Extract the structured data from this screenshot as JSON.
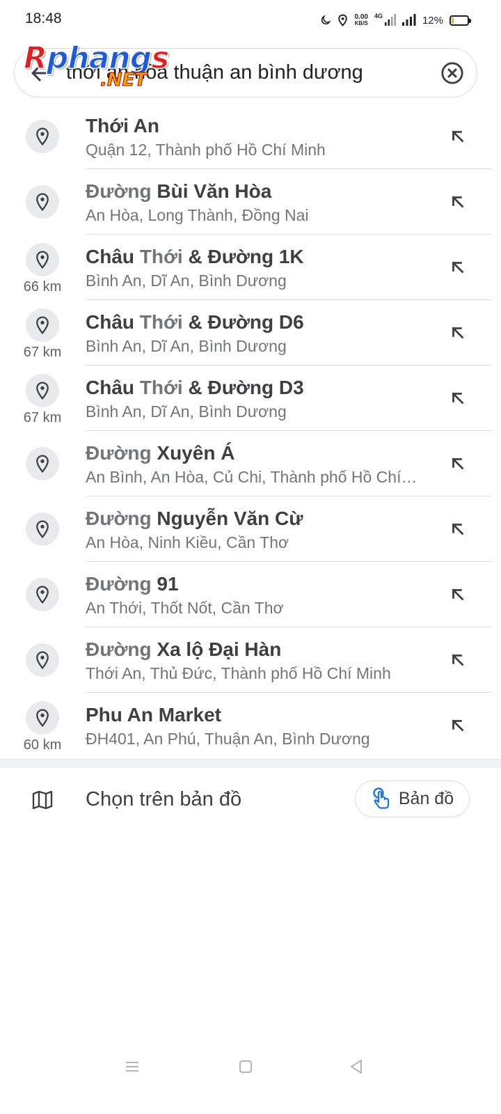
{
  "status_bar": {
    "time": "18:48",
    "net_speed_value": "0.00",
    "net_speed_unit": "KB/S",
    "network_type": "4G",
    "battery": "12%",
    "battery_level": 0.12,
    "icons": [
      "moon-icon",
      "location-icon",
      "signal-icon",
      "battery-icon"
    ]
  },
  "search": {
    "query": "thới an hòa thuận an bình dương",
    "back_icon": "arrow-left-icon",
    "clear_icon": "clear-circle-icon"
  },
  "watermark": {
    "main_r": "R",
    "main_mid": "phang",
    "main_s": "s",
    "sub": ".NET"
  },
  "results": [
    {
      "title_dim": "",
      "title_main": "Thới An",
      "title_parts": null,
      "subtitle": "Quận 12, Thành phố Hồ Chí Minh",
      "distance": ""
    },
    {
      "title_dim": "Đường ",
      "title_main": "Bùi Văn Hòa",
      "title_parts": null,
      "subtitle": "An Hòa, Long Thành, Đồng Nai",
      "distance": ""
    },
    {
      "title_parts": [
        [
          "Châu ",
          false
        ],
        [
          "Thới",
          true
        ],
        [
          " & Đường 1K",
          false
        ]
      ],
      "subtitle": "Bình An, Dĩ An, Bình Dương",
      "distance": "66 km"
    },
    {
      "title_parts": [
        [
          "Châu ",
          false
        ],
        [
          "Thới",
          true
        ],
        [
          " & Đường D6",
          false
        ]
      ],
      "subtitle": "Bình An, Dĩ An, Bình Dương",
      "distance": "67 km"
    },
    {
      "title_parts": [
        [
          "Châu ",
          false
        ],
        [
          "Thới",
          true
        ],
        [
          " & Đường D3",
          false
        ]
      ],
      "subtitle": "Bình An, Dĩ An, Bình Dương",
      "distance": "67 km"
    },
    {
      "title_dim": "Đường ",
      "title_main": "Xuyên Á",
      "title_parts": null,
      "subtitle": "An Bình, An Hòa, Củ Chi, Thành phố Hồ Chí…",
      "distance": ""
    },
    {
      "title_dim": "Đường ",
      "title_main": "Nguyễn Văn Cừ",
      "title_parts": null,
      "subtitle": "An Hòa, Ninh Kiều, Cần Thơ",
      "distance": ""
    },
    {
      "title_dim": "Đường ",
      "title_main": "91",
      "title_parts": null,
      "subtitle": "An Thới, Thốt Nốt, Cần Thơ",
      "distance": ""
    },
    {
      "title_dim": "Đường ",
      "title_main": "Xa lộ Đại Hàn",
      "title_parts": null,
      "subtitle": "Thới An, Thủ Đức, Thành phố Hồ Chí Minh",
      "distance": ""
    },
    {
      "title_dim": "",
      "title_main": "Phu An Market",
      "title_parts": null,
      "subtitle": "ĐH401, An Phú, Thuận An, Bình Dương",
      "distance": "60 km"
    }
  ],
  "choose_on_map": {
    "label": "Chọn trên bản đồ",
    "button_label": "Bản đồ"
  },
  "colors": {
    "accent_blue": "#1a73e8",
    "text_primary": "#3c4043",
    "text_secondary": "#70757a"
  }
}
